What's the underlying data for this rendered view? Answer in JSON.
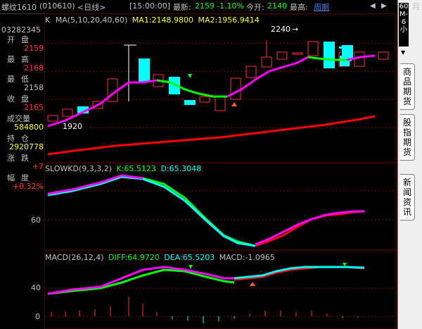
{
  "header": {
    "symbol": "螺纹1610",
    "code": "(010610)",
    "period": "<日线>",
    "time": "[15:00:00]",
    "latest_label": "最新:",
    "latest_value": "2159",
    "change_pct": "-1.10%",
    "open_label": "今开:",
    "open_value": "2140",
    "high_label": "最高:",
    "week_link": "周期",
    "month_char": "月"
  },
  "info_panel": {
    "volume_top": "03282345",
    "rows": [
      {
        "label": "开盘",
        "value": "2159",
        "color": "#ff3030"
      },
      {
        "label": "最高",
        "value": "2168",
        "color": "#ff3030"
      },
      {
        "label": "最低",
        "value": "2158",
        "color": "#c0c0c0"
      },
      {
        "label": "收盘",
        "value": "2165",
        "color": "#ff3030"
      },
      {
        "label": "成交量",
        "value": "584800",
        "color": "#ffff00"
      },
      {
        "label": "持仓",
        "value": "2920778",
        "color": "#ffff00"
      },
      {
        "label": "涨跌",
        "value": "+7",
        "color": "#ff3030"
      },
      {
        "label": "幅度",
        "value": "+0.32%",
        "color": "#ff3030"
      }
    ]
  },
  "panels": {
    "kline": {
      "title": "K",
      "ma_label": "MA(5,10,20,40,60)",
      "ma1": "MA1:2148.9800",
      "ma2": "MA2:1956.9414",
      "high_marker": "2240",
      "low_marker": "1920",
      "arrow": "→"
    },
    "kd": {
      "title": "SLOWKD(9,3,3,2)",
      "k": "K:65.5123",
      "d": "D:65.3048",
      "axis_label": "60"
    },
    "macd": {
      "title": "MACD(26,12,4)",
      "diff": "DIFF:64.9720",
      "dea": "DEA:65.5203",
      "macd": "MACD:-1.0965",
      "axis_40": "40",
      "axis_0": "0"
    }
  },
  "sidebar": {
    "scale_label": "60M-6小",
    "tabs": [
      "商品期货",
      "股指期货",
      "新闻资讯"
    ]
  },
  "colors": {
    "up": "#ff3030",
    "down": "#00ffff",
    "ma1": "#ff00ff",
    "ma_green": "#00ff00",
    "ma_red": "#ff0000",
    "grid": "#800000"
  }
}
